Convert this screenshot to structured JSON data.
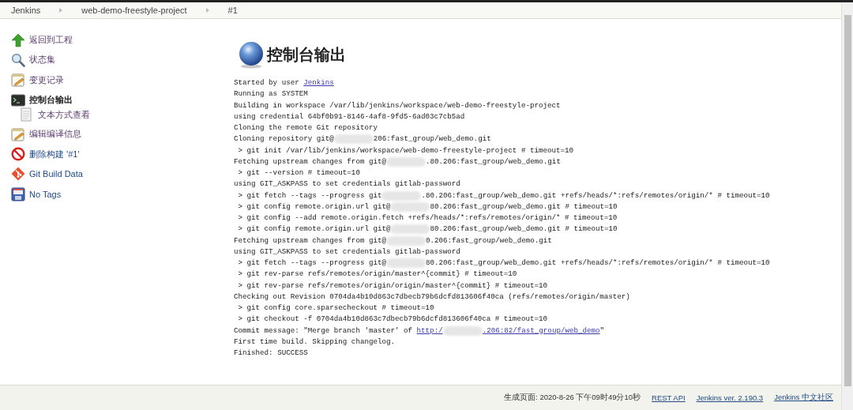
{
  "breadcrumbs": [
    {
      "label": "Jenkins"
    },
    {
      "label": "web-demo-freestyle-project"
    },
    {
      "label": "#1"
    }
  ],
  "sidebar": {
    "items": [
      {
        "label": "返回到工程",
        "selected": false
      },
      {
        "label": "状态集",
        "selected": false
      },
      {
        "label": "变更记录",
        "selected": false
      },
      {
        "label": "控制台输出",
        "selected": true,
        "children": [
          {
            "label": "文本方式查看",
            "selected": false
          }
        ]
      },
      {
        "label": "编辑编译信息",
        "selected": false
      },
      {
        "label": "删除构建 '#1'",
        "selected": false
      },
      {
        "label": "Git Build Data",
        "selected": false
      },
      {
        "label": "No Tags",
        "selected": false
      }
    ]
  },
  "page": {
    "title": "控制台输出"
  },
  "console": {
    "lines": [
      {
        "parts": [
          {
            "kind": "plain",
            "text": "Started by user "
          },
          {
            "kind": "link",
            "text": "Jenkins"
          }
        ]
      },
      {
        "parts": [
          {
            "kind": "plain",
            "text": "Running as SYSTEM"
          }
        ]
      },
      {
        "parts": [
          {
            "kind": "plain",
            "text": "Building in workspace /var/lib/jenkins/workspace/web-demo-freestyle-project"
          }
        ]
      },
      {
        "parts": [
          {
            "kind": "plain",
            "text": "using credential 64bf0b91-8146-4af8-9fd5-6ad03c7cb5ad"
          }
        ]
      },
      {
        "parts": [
          {
            "kind": "plain",
            "text": "Cloning the remote Git repository"
          }
        ]
      },
      {
        "parts": [
          {
            "kind": "plain",
            "text": "Cloning repository git@"
          },
          {
            "kind": "redacted"
          },
          {
            "kind": "plain",
            "text": "206:fast_group/web_demo.git"
          }
        ]
      },
      {
        "parts": [
          {
            "kind": "plain",
            "text": " > git init /var/lib/jenkins/workspace/web-demo-freestyle-project # timeout=10"
          }
        ]
      },
      {
        "parts": [
          {
            "kind": "plain",
            "text": "Fetching upstream changes from git@"
          },
          {
            "kind": "redacted"
          },
          {
            "kind": "plain",
            "text": ".80.206:fast_group/web_demo.git"
          }
        ]
      },
      {
        "parts": [
          {
            "kind": "plain",
            "text": " > git --version # timeout=10"
          }
        ]
      },
      {
        "parts": [
          {
            "kind": "plain",
            "text": "using GIT_ASKPASS to set credentials gitlab-password"
          }
        ]
      },
      {
        "parts": [
          {
            "kind": "plain",
            "text": " > git fetch --tags --progress git"
          },
          {
            "kind": "redacted"
          },
          {
            "kind": "plain",
            "text": ".80.206:fast_group/web_demo.git +refs/heads/*:refs/remotes/origin/* # timeout=10"
          }
        ]
      },
      {
        "parts": [
          {
            "kind": "plain",
            "text": " > git config remote.origin.url git@"
          },
          {
            "kind": "redacted"
          },
          {
            "kind": "plain",
            "text": "80.206:fast_group/web_demo.git # timeout=10"
          }
        ]
      },
      {
        "parts": [
          {
            "kind": "plain",
            "text": " > git config --add remote.origin.fetch +refs/heads/*:refs/remotes/origin/* # timeout=10"
          }
        ]
      },
      {
        "parts": [
          {
            "kind": "plain",
            "text": " > git config remote.origin.url git@"
          },
          {
            "kind": "redacted"
          },
          {
            "kind": "plain",
            "text": "80.206:fast_group/web_demo.git # timeout=10"
          }
        ]
      },
      {
        "parts": [
          {
            "kind": "plain",
            "text": "Fetching upstream changes from git@"
          },
          {
            "kind": "redacted"
          },
          {
            "kind": "plain",
            "text": "0.206:fast_group/web_demo.git"
          }
        ]
      },
      {
        "parts": [
          {
            "kind": "plain",
            "text": "using GIT_ASKPASS to set credentials gitlab-password"
          }
        ]
      },
      {
        "parts": [
          {
            "kind": "plain",
            "text": " > git fetch --tags --progress git@"
          },
          {
            "kind": "redacted"
          },
          {
            "kind": "plain",
            "text": "80.206:fast_group/web_demo.git +refs/heads/*:refs/remotes/origin/* # timeout=10"
          }
        ]
      },
      {
        "parts": [
          {
            "kind": "plain",
            "text": " > git rev-parse refs/remotes/origin/master^{commit} # timeout=10"
          }
        ]
      },
      {
        "parts": [
          {
            "kind": "plain",
            "text": " > git rev-parse refs/remotes/origin/origin/master^{commit} # timeout=10"
          }
        ]
      },
      {
        "parts": [
          {
            "kind": "plain",
            "text": "Checking out Revision 0704da4b10d863c7dbecb79b6dcfd813606f40ca (refs/remotes/origin/master)"
          }
        ]
      },
      {
        "parts": [
          {
            "kind": "plain",
            "text": " > git config core.sparsecheckout # timeout=10"
          }
        ]
      },
      {
        "parts": [
          {
            "kind": "plain",
            "text": " > git checkout -f 0704da4b10d863c7dbecb79b6dcfd813606f40ca # timeout=10"
          }
        ]
      },
      {
        "parts": [
          {
            "kind": "plain",
            "text": "Commit message: \"Merge branch 'master' of "
          },
          {
            "kind": "link",
            "text": "http:/"
          },
          {
            "kind": "redacted"
          },
          {
            "kind": "link",
            "text": ".206:82/fast_group/web_demo"
          },
          {
            "kind": "plain",
            "text": "\""
          }
        ]
      },
      {
        "parts": [
          {
            "kind": "plain",
            "text": "First time build. Skipping changelog."
          }
        ]
      },
      {
        "parts": [
          {
            "kind": "plain",
            "text": "Finished: SUCCESS"
          }
        ]
      }
    ]
  },
  "footer": {
    "generated": "生成页面: 2020-8-26 下午09时49分10秒",
    "links": [
      {
        "label": "REST API"
      },
      {
        "label": "Jenkins ver. 2.190.3"
      },
      {
        "label": "Jenkins 中文社区"
      }
    ]
  }
}
